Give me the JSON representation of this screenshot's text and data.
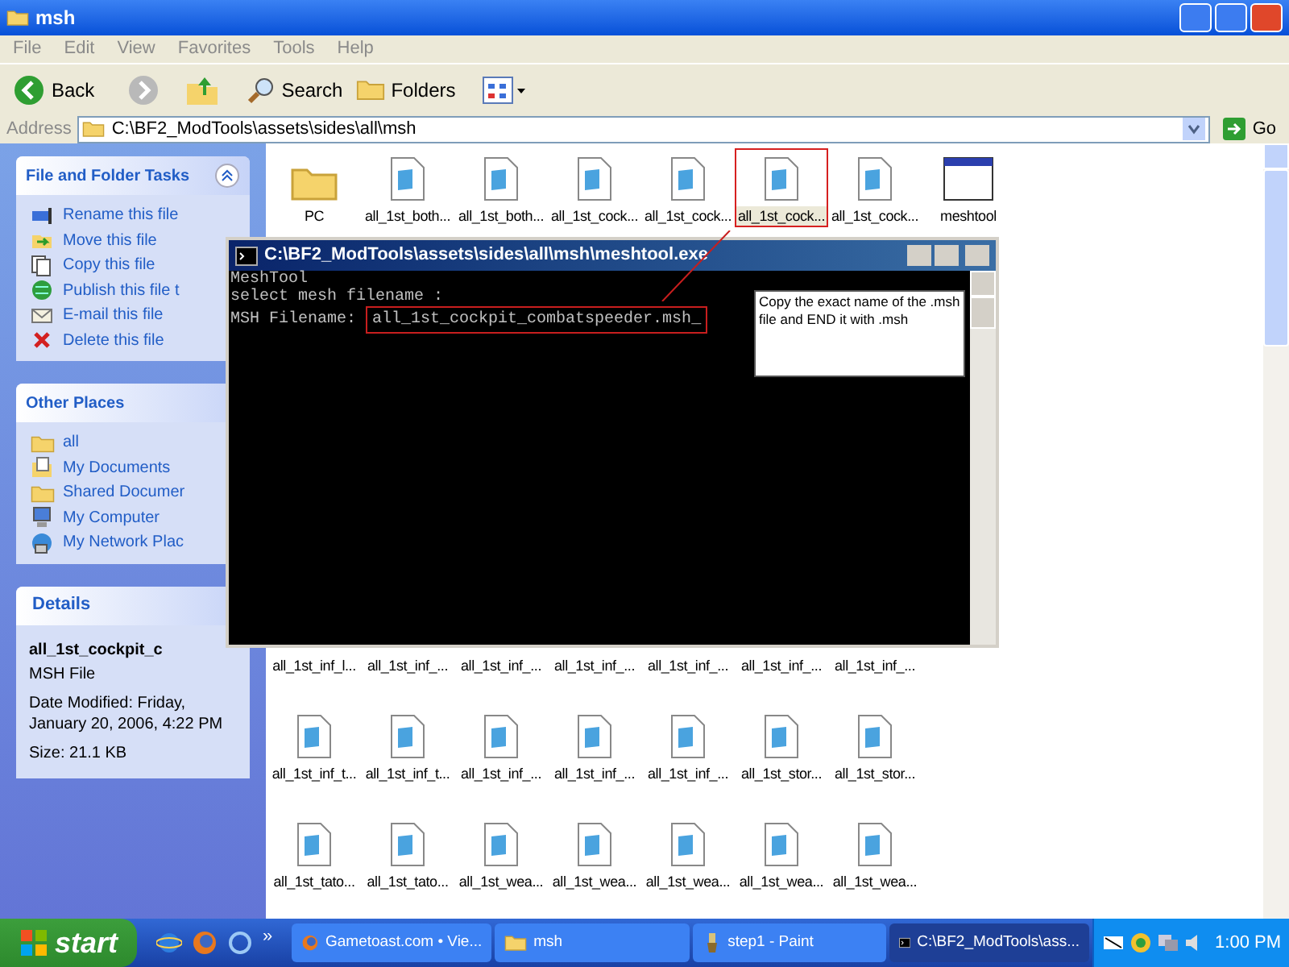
{
  "window": {
    "title": "msh"
  },
  "menu": [
    "File",
    "Edit",
    "View",
    "Favorites",
    "Tools",
    "Help"
  ],
  "toolbar": {
    "back": "Back",
    "search": "Search",
    "folders": "Folders"
  },
  "address": {
    "label": "Address",
    "value": "C:\\BF2_ModTools\\assets\\sides\\all\\msh",
    "go": "Go"
  },
  "sidebar": {
    "panels": [
      {
        "title": "File and Folder Tasks",
        "items": [
          {
            "label": "Rename this file",
            "kind": "rename"
          },
          {
            "label": "Move this file",
            "kind": "move"
          },
          {
            "label": "Copy this file",
            "kind": "copy"
          },
          {
            "label": "Publish this file t",
            "kind": "publish"
          },
          {
            "label": "E-mail this file",
            "kind": "email"
          },
          {
            "label": "Delete this file",
            "kind": "delete"
          }
        ]
      },
      {
        "title": "Other Places",
        "items": [
          {
            "label": "all",
            "kind": "folder"
          },
          {
            "label": "My Documents",
            "kind": "documents"
          },
          {
            "label": "Shared Documer",
            "kind": "folder"
          },
          {
            "label": "My Computer",
            "kind": "computer"
          },
          {
            "label": "My Network Plac",
            "kind": "network"
          }
        ]
      }
    ],
    "details": {
      "title": "Details",
      "name": "all_1st_cockpit_c",
      "type": "MSH File",
      "modified": "Date Modified: Friday, January 20, 2006, 4:22 PM",
      "size": "Size: 21.1 KB"
    }
  },
  "files": [
    [
      {
        "label": "PC",
        "kind": "folder",
        "selected": false
      },
      {
        "label": "all_1st_both...",
        "kind": "file",
        "selected": false
      },
      {
        "label": "all_1st_both...",
        "kind": "file",
        "selected": false
      },
      {
        "label": "all_1st_cock...",
        "kind": "file",
        "selected": false
      },
      {
        "label": "all_1st_cock...",
        "kind": "file",
        "selected": false
      },
      {
        "label": "all_1st_cock...",
        "kind": "file",
        "selected": true
      },
      {
        "label": "all_1st_cock...",
        "kind": "file",
        "selected": false
      },
      {
        "label": "meshtool",
        "kind": "app",
        "selected": false
      }
    ],
    [
      {
        "label": "all_1st_inf_l...",
        "kind": "covered",
        "selected": false
      },
      {
        "label": "all_1st_inf_...",
        "kind": "covered",
        "selected": false
      },
      {
        "label": "all_1st_inf_...",
        "kind": "covered",
        "selected": false
      },
      {
        "label": "all_1st_inf_...",
        "kind": "covered",
        "selected": false
      },
      {
        "label": "all_1st_inf_...",
        "kind": "covered",
        "selected": false
      },
      {
        "label": "all_1st_inf_...",
        "kind": "covered",
        "selected": false
      },
      {
        "label": "all_1st_inf_...",
        "kind": "covered",
        "selected": false
      }
    ],
    [
      {
        "label": "all_1st_inf_t...",
        "kind": "file",
        "selected": false
      },
      {
        "label": "all_1st_inf_t...",
        "kind": "file",
        "selected": false
      },
      {
        "label": "all_1st_inf_...",
        "kind": "file",
        "selected": false
      },
      {
        "label": "all_1st_inf_...",
        "kind": "file",
        "selected": false
      },
      {
        "label": "all_1st_inf_...",
        "kind": "file",
        "selected": false
      },
      {
        "label": "all_1st_stor...",
        "kind": "file",
        "selected": false
      },
      {
        "label": "all_1st_stor...",
        "kind": "file",
        "selected": false
      }
    ],
    [
      {
        "label": "all_1st_tato...",
        "kind": "file",
        "selected": false
      },
      {
        "label": "all_1st_tato...",
        "kind": "file",
        "selected": false
      },
      {
        "label": "all_1st_wea...",
        "kind": "file",
        "selected": false
      },
      {
        "label": "all_1st_wea...",
        "kind": "file",
        "selected": false
      },
      {
        "label": "all_1st_wea...",
        "kind": "file",
        "selected": false
      },
      {
        "label": "all_1st_wea...",
        "kind": "file",
        "selected": false
      },
      {
        "label": "all_1st_wea...",
        "kind": "file",
        "selected": false
      }
    ]
  ],
  "console": {
    "title": "C:\\BF2_ModTools\\assets\\sides\\all\\msh\\meshtool.exe",
    "lines": [
      "MeshTool",
      "select mesh filename :"
    ],
    "prompt": "MSH Filename:",
    "value": "all_1st_cockpit_combatspeeder.msh",
    "cursor": "_"
  },
  "callout": {
    "text": "Copy the exact name of the .msh file and END it with .msh"
  },
  "taskbar": {
    "start": "start",
    "more": "»",
    "tasks": [
      {
        "label": "Gametoast.com • Vie...",
        "kind": "browser",
        "selected": false
      },
      {
        "label": "msh",
        "kind": "folder",
        "selected": false
      },
      {
        "label": "step1 - Paint",
        "kind": "paint",
        "selected": false
      },
      {
        "label": "C:\\BF2_ModTools\\ass...",
        "kind": "console",
        "selected": true
      }
    ],
    "clock": "1:00 PM"
  }
}
